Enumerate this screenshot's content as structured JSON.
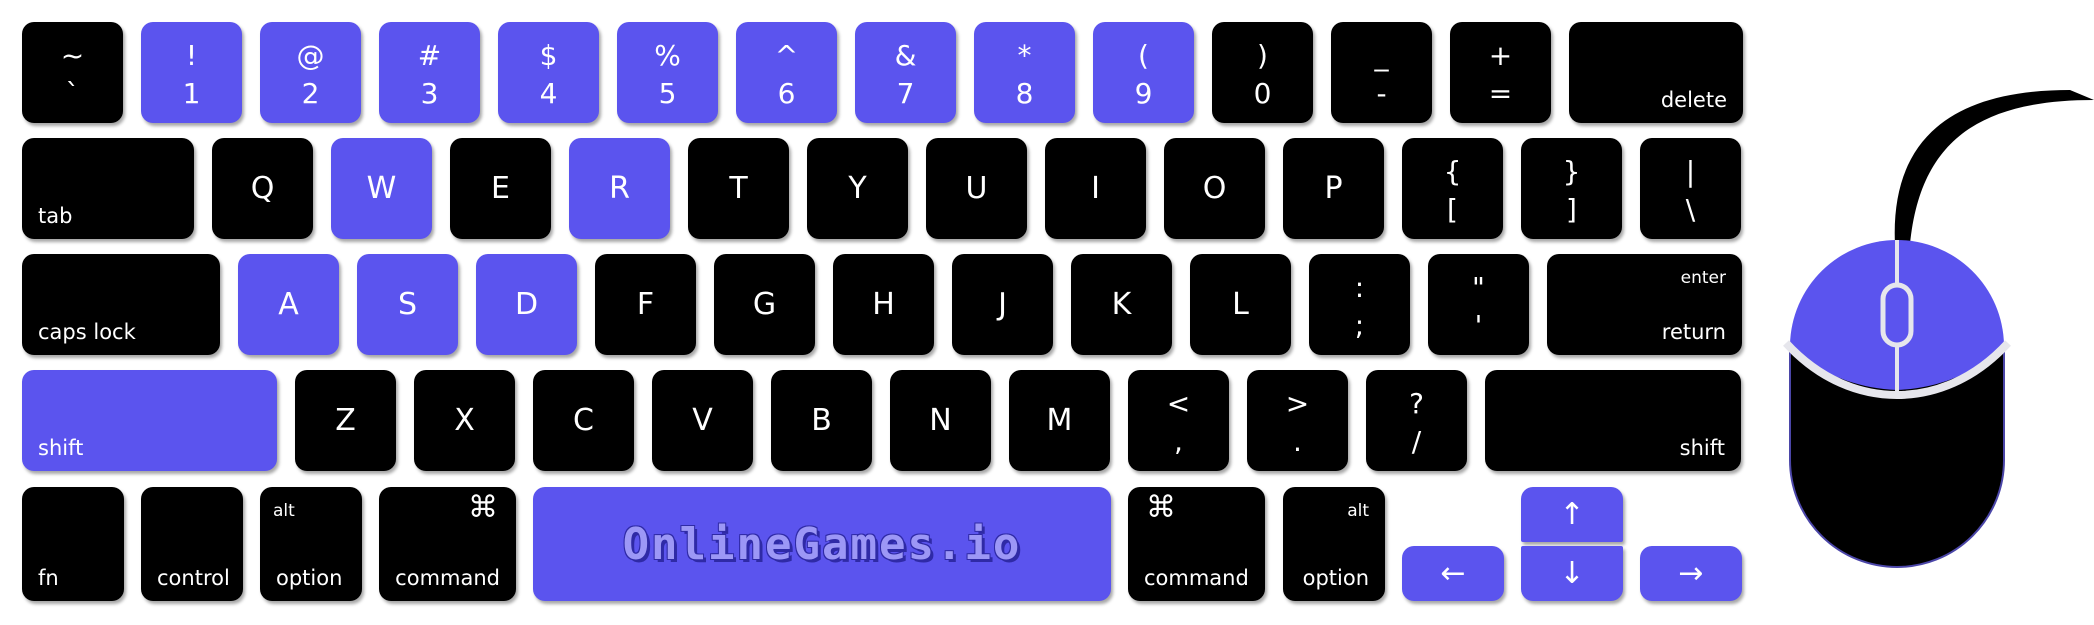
{
  "colors": {
    "highlight": "#5b54ee",
    "key": "#000000",
    "text": "#ffffff",
    "mouse_line": "#e6e6ec",
    "logo_text": "#9c97f6",
    "logo_shadow": "#2f2aa6"
  },
  "rows": [
    [
      {
        "top": "~",
        "bot": "`",
        "hl": false
      },
      {
        "top": "!",
        "bot": "1",
        "hl": true
      },
      {
        "top": "@",
        "bot": "2",
        "hl": true
      },
      {
        "top": "#",
        "bot": "3",
        "hl": true
      },
      {
        "top": "$",
        "bot": "4",
        "hl": true
      },
      {
        "top": "%",
        "bot": "5",
        "hl": true
      },
      {
        "top": "^",
        "bot": "6",
        "hl": true
      },
      {
        "top": "&",
        "bot": "7",
        "hl": true
      },
      {
        "top": "*",
        "bot": "8",
        "hl": true
      },
      {
        "top": "(",
        "bot": "9",
        "hl": true
      },
      {
        "top": ")",
        "bot": "0",
        "hl": false
      },
      {
        "top": "_",
        "bot": "-",
        "hl": false
      },
      {
        "top": "+",
        "bot": "=",
        "hl": false
      },
      {
        "label": "delete",
        "hl": false
      }
    ],
    [
      {
        "label": "tab",
        "hl": false
      },
      {
        "char": "Q",
        "hl": false
      },
      {
        "char": "W",
        "hl": true
      },
      {
        "char": "E",
        "hl": false
      },
      {
        "char": "R",
        "hl": true
      },
      {
        "char": "T",
        "hl": false
      },
      {
        "char": "Y",
        "hl": false
      },
      {
        "char": "U",
        "hl": false
      },
      {
        "char": "I",
        "hl": false
      },
      {
        "char": "O",
        "hl": false
      },
      {
        "char": "P",
        "hl": false
      },
      {
        "top": "{",
        "bot": "[",
        "hl": false
      },
      {
        "top": "}",
        "bot": "]",
        "hl": false
      },
      {
        "top": "|",
        "bot": "\\",
        "hl": false
      }
    ],
    [
      {
        "label": "caps lock",
        "hl": false
      },
      {
        "char": "A",
        "hl": true
      },
      {
        "char": "S",
        "hl": true
      },
      {
        "char": "D",
        "hl": true
      },
      {
        "char": "F",
        "hl": false
      },
      {
        "char": "G",
        "hl": false
      },
      {
        "char": "H",
        "hl": false
      },
      {
        "char": "J",
        "hl": false
      },
      {
        "char": "K",
        "hl": false
      },
      {
        "char": "L",
        "hl": false
      },
      {
        "top": ":",
        "bot": ";",
        "hl": false
      },
      {
        "top": "\"",
        "bot": "'",
        "hl": false
      },
      {
        "label": "return",
        "sub": "enter",
        "hl": false
      }
    ],
    [
      {
        "label": "shift",
        "hl": true
      },
      {
        "char": "Z",
        "hl": false
      },
      {
        "char": "X",
        "hl": false
      },
      {
        "char": "C",
        "hl": false
      },
      {
        "char": "V",
        "hl": false
      },
      {
        "char": "B",
        "hl": false
      },
      {
        "char": "N",
        "hl": false
      },
      {
        "char": "M",
        "hl": false
      },
      {
        "top": "<",
        "bot": ",",
        "hl": false
      },
      {
        "top": ">",
        "bot": ".",
        "hl": false
      },
      {
        "top": "?",
        "bot": "/",
        "hl": false
      },
      {
        "label": "shift",
        "hl": false
      }
    ]
  ],
  "bottom_row": {
    "fn": "fn",
    "control": "control",
    "option_left": {
      "label": "option",
      "sub": "alt"
    },
    "command_left": {
      "label": "command",
      "symbol": "⌘"
    },
    "space": {
      "logo": "OnlineGames.io",
      "hl": true
    },
    "command_right": {
      "label": "command",
      "symbol": "⌘"
    },
    "option_right": {
      "label": "option",
      "sub": "alt"
    },
    "arrows": {
      "up": "↑",
      "down": "↓",
      "left": "←",
      "right": "→",
      "hl": true
    }
  },
  "mouse": {
    "left_button_highlighted": true,
    "right_button_highlighted": true,
    "scroll_wheel": true
  }
}
